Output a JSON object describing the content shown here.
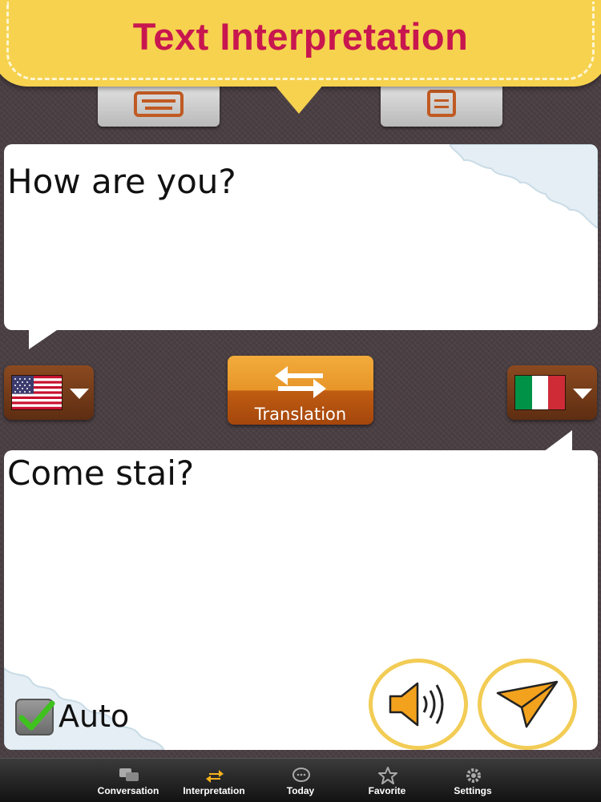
{
  "header": {
    "title": "Text Interpretation"
  },
  "input_panel": {
    "text": "How are you?"
  },
  "output_panel": {
    "text": "Come stai?"
  },
  "source_language": {
    "flag": "us-flag-icon"
  },
  "target_language": {
    "flag": "italy-flag-icon"
  },
  "translate_button": {
    "label": "Translation"
  },
  "auto": {
    "label": "Auto",
    "checked": true
  },
  "colors": {
    "banner": "#f6d24f",
    "title": "#c8164f",
    "accent": "#f2cc55",
    "button": "#e79528",
    "check": "#3fc21e"
  },
  "tabbar": {
    "tabs": [
      {
        "label": "Conversation",
        "icon": "chat-bubbles-icon",
        "active": false
      },
      {
        "label": "Interpretation",
        "icon": "swap-arrows-icon",
        "active": true
      },
      {
        "label": "Today",
        "icon": "speech-bubble-icon",
        "active": false
      },
      {
        "label": "Favorite",
        "icon": "star-icon",
        "active": false
      },
      {
        "label": "Settings",
        "icon": "gear-icon",
        "active": false
      }
    ]
  }
}
